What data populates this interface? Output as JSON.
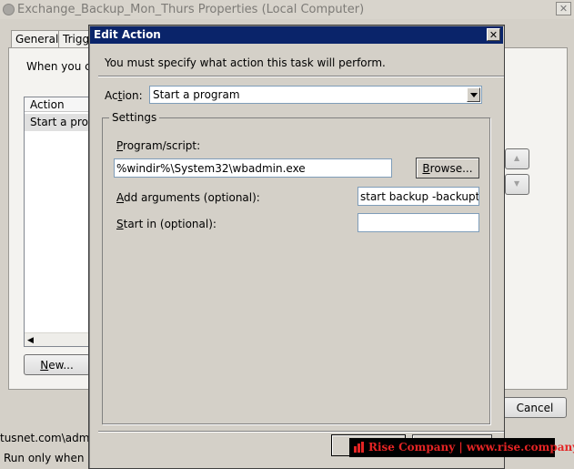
{
  "background_window": {
    "title": "Exchange_Backup_Mon_Thurs Properties (Local Computer)",
    "close_glyph": "✕",
    "tabs": [
      "General",
      "Trigg"
    ],
    "description": "When you cr",
    "action_list": {
      "header": "Action",
      "row": "Start a progr"
    },
    "new_button": {
      "pre": "",
      "mnemonic": "N",
      "post": "ew..."
    },
    "cancel_button": "Cancel",
    "footer_user": "tusnet.com\\admin",
    "footer_run": "Run only when us"
  },
  "dialog": {
    "title": "Edit Action",
    "close_glyph": "✕",
    "message": "You must specify what action this task will perform.",
    "action_label": {
      "pre": "Ac",
      "mnemonic": "t",
      "post": "ion:"
    },
    "action_value": "Start a program",
    "settings_legend": "Settings",
    "program_label": {
      "pre": "",
      "mnemonic": "P",
      "post": "rogram/script:"
    },
    "program_value": "%windir%\\System32\\wbadmin.exe",
    "browse_button": {
      "pre": "",
      "mnemonic": "B",
      "post": "rowse..."
    },
    "args_label": {
      "pre": "",
      "mnemonic": "A",
      "post": "dd arguments (optional):"
    },
    "args_value": "start backup -backuptarg",
    "startin_label": {
      "pre": "",
      "mnemonic": "S",
      "post": "tart in (optional):"
    },
    "startin_value": ""
  },
  "watermark": {
    "text": "Rise Company | www.rise.company"
  },
  "colors": {
    "dialog_title_bar": "#0a246a",
    "watermark_text": "#e42424"
  }
}
